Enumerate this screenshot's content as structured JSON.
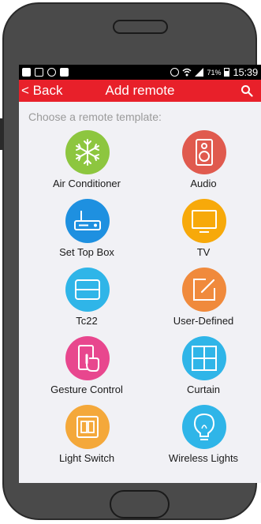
{
  "status_bar": {
    "battery_percent": "71%",
    "time": "15:39"
  },
  "app_bar": {
    "back_label": "< Back",
    "title": "Add remote",
    "search_icon": "search-icon"
  },
  "prompt": "Choose a remote template:",
  "templates": [
    {
      "label": "Air Conditioner",
      "icon": "snowflake-icon",
      "color": "#8dc63f"
    },
    {
      "label": "Audio",
      "icon": "speaker-icon",
      "color": "#e05a4e"
    },
    {
      "label": "Set Top Box",
      "icon": "set-top-box-icon",
      "color": "#1e90e0"
    },
    {
      "label": "TV",
      "icon": "tv-icon",
      "color": "#f7a90a"
    },
    {
      "label": "Tc22",
      "icon": "tc22-icon",
      "color": "#2fb5e8"
    },
    {
      "label": "User-Defined",
      "icon": "edit-icon",
      "color": "#f08a3c"
    },
    {
      "label": "Gesture Control",
      "icon": "gesture-icon",
      "color": "#e8478e"
    },
    {
      "label": "Curtain",
      "icon": "curtain-icon",
      "color": "#2fb5e8"
    },
    {
      "label": "Light Switch",
      "icon": "light-switch-icon",
      "color": "#f4a83a"
    },
    {
      "label": "Wireless Lights",
      "icon": "light-bulb-icon",
      "color": "#2fb5e8"
    }
  ]
}
